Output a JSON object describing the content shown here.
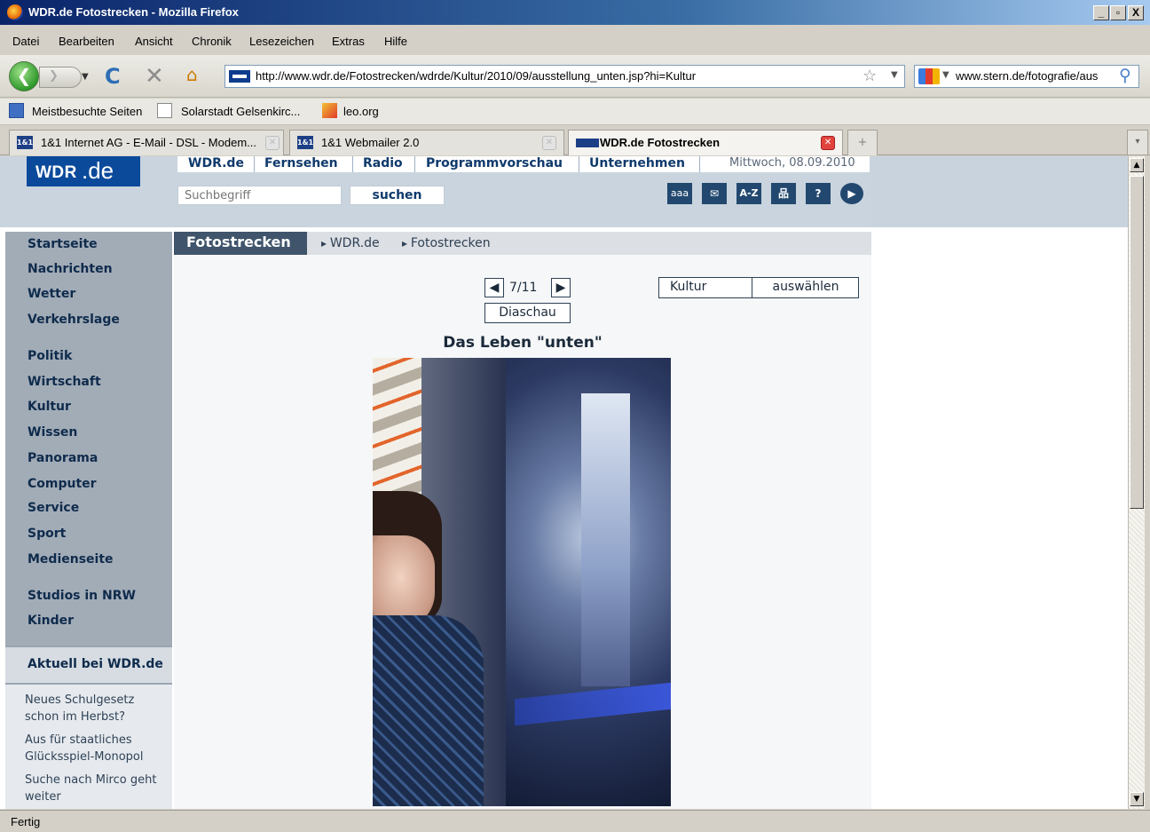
{
  "window": {
    "title": "WDR.de Fotostrecken - Mozilla Firefox",
    "btn_min": "_",
    "btn_max": "▫",
    "btn_close": "X"
  },
  "menu": [
    "Datei",
    "Bearbeiten",
    "Ansicht",
    "Chronik",
    "Lesezeichen",
    "Extras",
    "Hilfe"
  ],
  "toolbar": {
    "url": "http://www.wdr.de/Fotostrecken/wdrde/Kultur/2010/09/ausstellung_unten.jsp?hi=Kultur",
    "search_text": "www.stern.de/fotografie/aus"
  },
  "bookmarks": [
    "Meistbesuchte Seiten",
    "Solarstadt Gelsenkirc...",
    "leo.org"
  ],
  "tabs": [
    {
      "label": "1&1 Internet AG - E-Mail - DSL - Modem...",
      "fav": "1&1"
    },
    {
      "label": "1&1 Webmailer 2.0",
      "fav": "1&1"
    },
    {
      "label": "WDR.de Fotostrecken",
      "fav": ""
    }
  ],
  "header": {
    "logo_wdr": "WDR",
    "logo_de": ".de",
    "nav": [
      "WDR.de",
      "Fernsehen",
      "Radio",
      "Programmvorschau",
      "Unternehmen"
    ],
    "date": "Mittwoch, 08.09.2010",
    "search_placeholder": "Suchbegriff",
    "search_button": "suchen",
    "icons": [
      {
        "name": "font-size-icon",
        "glyph": "aaa"
      },
      {
        "name": "mail-icon",
        "glyph": "✉"
      },
      {
        "name": "az-index-icon",
        "glyph": "A-Z"
      },
      {
        "name": "sitemap-icon",
        "glyph": "品"
      },
      {
        "name": "help-icon",
        "glyph": "?"
      },
      {
        "name": "player-icon",
        "glyph": "▶"
      }
    ]
  },
  "sidebar": {
    "items": [
      "Startseite",
      "Nachrichten",
      "Wetter",
      "Verkehrslage",
      "Politik",
      "Wirtschaft",
      "Kultur",
      "Wissen",
      "Panorama",
      "Computer",
      "Service",
      "Sport",
      "Medienseite",
      "Studios in NRW",
      "Kinder"
    ],
    "aktuell_title": "Aktuell bei WDR.de",
    "news": [
      "Neues Schulgesetz schon im Herbst?",
      "Aus für staatliches Glücksspiel-Monopol",
      "Suche nach Mirco geht weiter"
    ]
  },
  "content": {
    "section_title": "Fotostrecken",
    "breadcrumbs": [
      "WDR.de",
      "Fotostrecken"
    ],
    "counter": "7/11",
    "prev": "◀",
    "next": "▶",
    "slideshow": "Diaschau",
    "category": "Kultur",
    "category_button": "auswählen",
    "photo_title": "Das Leben \"unten\""
  },
  "status": "Fertig"
}
